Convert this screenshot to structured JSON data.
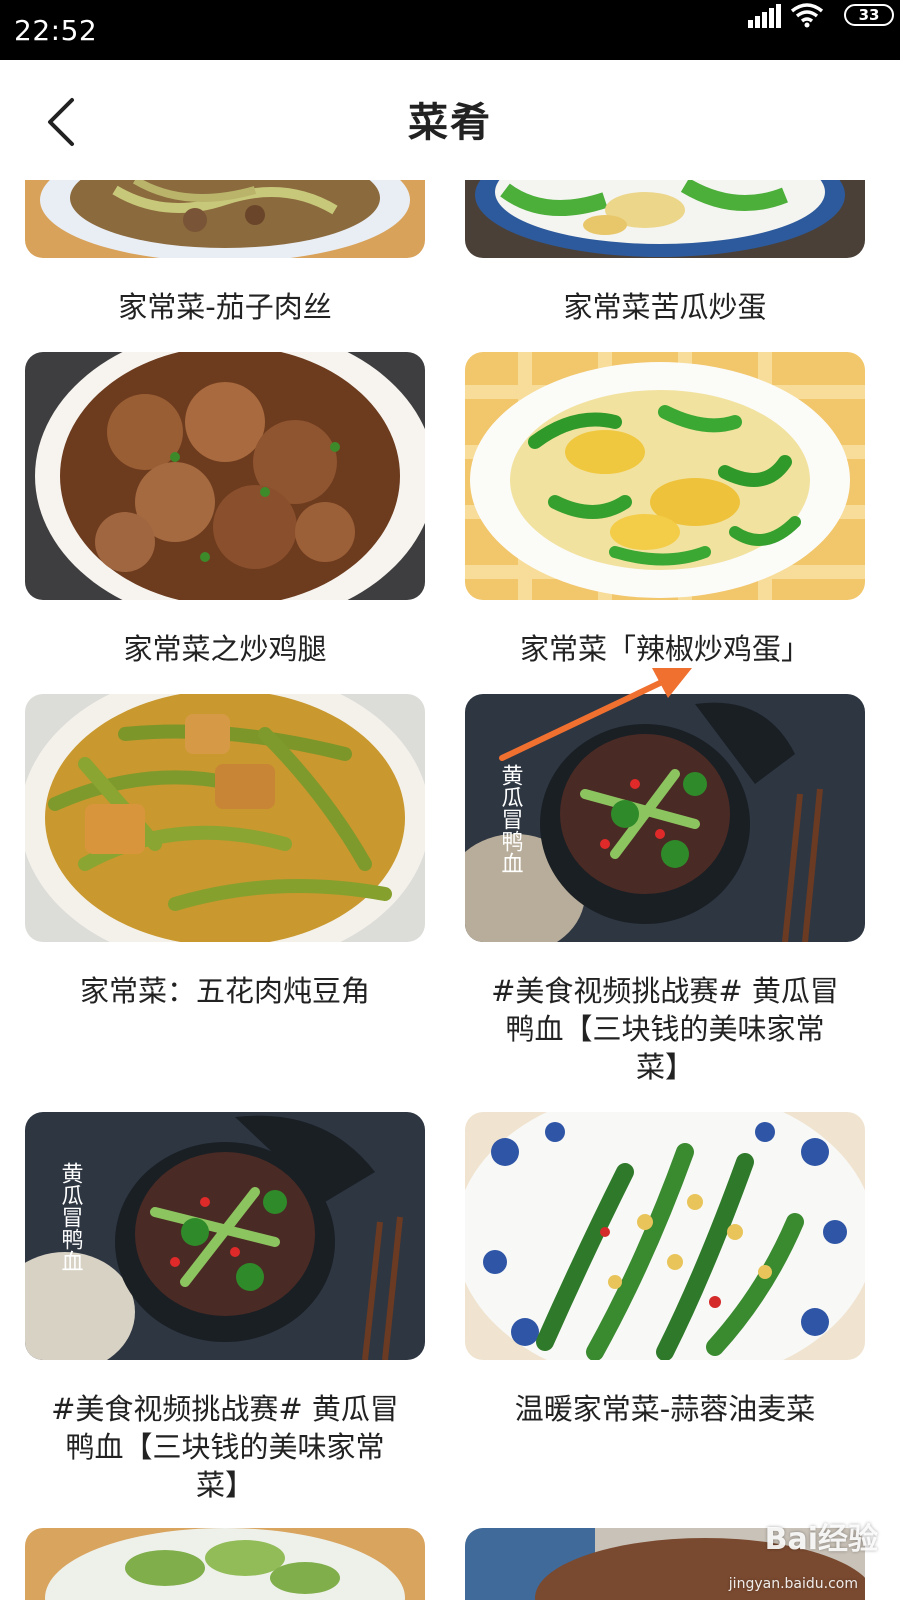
{
  "status_bar": {
    "time": "22:52",
    "battery": "33"
  },
  "header": {
    "title": "菜肴",
    "back_icon": "chevron-left-icon"
  },
  "recipes": [
    {
      "title": "家常菜-茄子肉丝"
    },
    {
      "title": "家常菜苦瓜炒蛋"
    },
    {
      "title": "家常菜之炒鸡腿"
    },
    {
      "title": "家常菜「辣椒炒鸡蛋」"
    },
    {
      "title": "家常菜：五花肉炖豆角"
    },
    {
      "title_lines": [
        "#美食视频挑战赛# 黄瓜冒",
        "鸭血【三块钱的美味家常",
        "菜】"
      ]
    },
    {
      "title_lines": [
        "#美食视频挑战赛# 黄瓜冒",
        "鸭血【三块钱的美味家常",
        "菜】"
      ]
    },
    {
      "title": "温暖家常菜-蒜蓉油麦菜"
    }
  ],
  "image_text": {
    "duck_blood": "黄瓜冒鸭血"
  },
  "watermark": {
    "brand": "Bai经验",
    "url": "jingyan.baidu.com"
  },
  "colors": {
    "arrow": "#f07030",
    "title_text": "#222222"
  }
}
